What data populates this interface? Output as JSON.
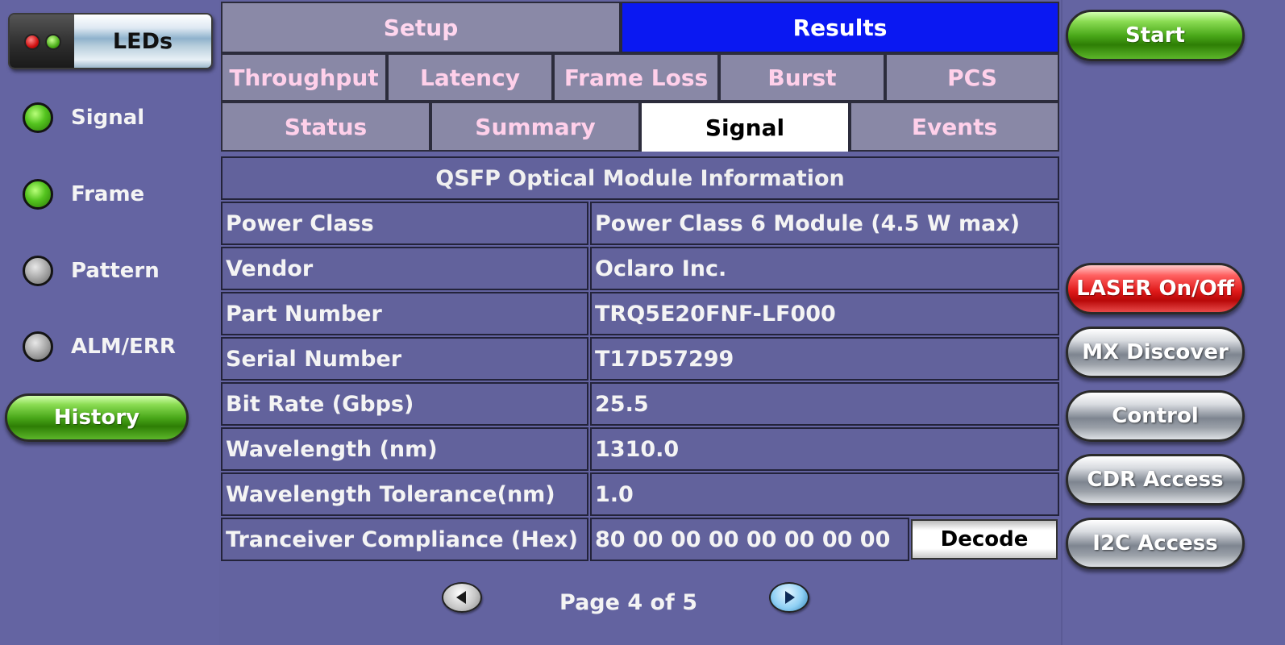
{
  "leds_panel": {
    "title": "LEDs",
    "items": [
      {
        "label": "Signal",
        "state": "green"
      },
      {
        "label": "Frame",
        "state": "green"
      },
      {
        "label": "Pattern",
        "state": "grey"
      },
      {
        "label": "ALM/ERR",
        "state": "grey"
      }
    ],
    "history_label": "History"
  },
  "top_tabs": [
    {
      "label": "Setup",
      "active": false
    },
    {
      "label": "Results",
      "active": true
    }
  ],
  "result_tabs": [
    {
      "label": "Throughput"
    },
    {
      "label": "Latency"
    },
    {
      "label": "Frame Loss"
    },
    {
      "label": "Burst"
    },
    {
      "label": "PCS"
    }
  ],
  "view_tabs": [
    {
      "label": "Status",
      "active": false
    },
    {
      "label": "Summary",
      "active": false
    },
    {
      "label": "Signal",
      "active": true
    },
    {
      "label": "Events",
      "active": false
    }
  ],
  "module_info": {
    "title": "QSFP Optical Module Information",
    "rows": [
      {
        "label": "Power Class",
        "value": "Power Class 6 Module (4.5 W max)"
      },
      {
        "label": "Vendor",
        "value": "Oclaro Inc."
      },
      {
        "label": "Part Number",
        "value": "TRQ5E20FNF-LF000"
      },
      {
        "label": "Serial Number",
        "value": "T17D57299"
      },
      {
        "label": "Bit Rate (Gbps)",
        "value": "25.5"
      },
      {
        "label": "Wavelength (nm)",
        "value": "1310.0"
      },
      {
        "label": "Wavelength Tolerance(nm)",
        "value": "1.0"
      },
      {
        "label": "Tranceiver Compliance (Hex)",
        "value": "80 00 00 00 00 00 00 00"
      }
    ],
    "decode_label": "Decode"
  },
  "pager": {
    "label": "Page 4 of 5",
    "current": 4,
    "total": 5
  },
  "right_panel": {
    "start_label": "Start",
    "laser_label": "LASER On/Off",
    "mx_discover_label": "MX Discover",
    "control_label": "Control",
    "cdr_access_label": "CDR Access",
    "i2c_access_label": "I2C Access"
  },
  "colors": {
    "background": "#6363a0",
    "active_tab_blue": "#0a18f2",
    "inactive_tab": "#8a89a7",
    "inactive_tab_text": "#ffd6ee",
    "led_green": "#54c41f",
    "led_grey": "#a8a8a8",
    "laser_red": "#e01a1a"
  },
  "icons": {
    "prev_page": "left-arrow-icon",
    "next_page": "right-arrow-icon"
  }
}
